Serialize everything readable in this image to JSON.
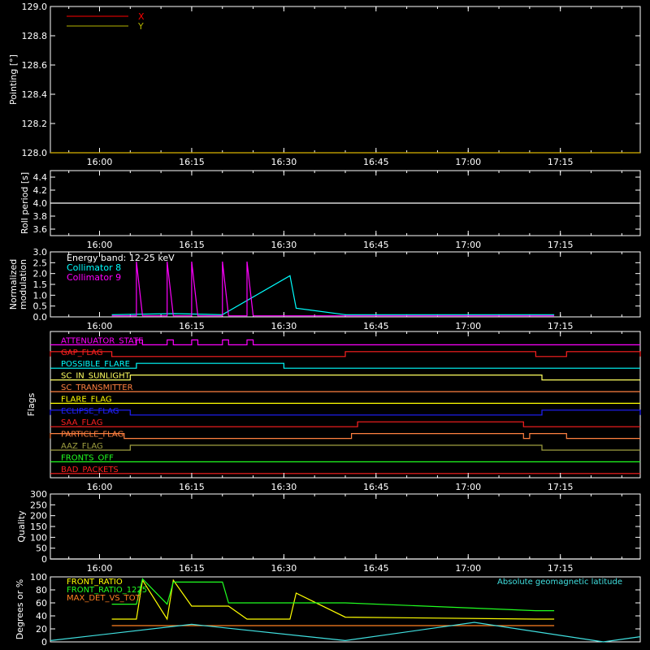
{
  "time_ticks": [
    "16:00",
    "16:15",
    "16:30",
    "16:45",
    "17:00",
    "17:15"
  ],
  "chart_data": [
    {
      "panel": "pointing",
      "type": "line",
      "ylabel": "Pointing [°]",
      "ylim": [
        128.0,
        129.0
      ],
      "yticks": [
        "129.0",
        "128.8",
        "128.6",
        "128.4",
        "128.2",
        "128.0"
      ],
      "series": [
        {
          "name": "X",
          "color": "#ff0000",
          "x": [
            "15:52",
            "17:28"
          ],
          "y": [
            128.0,
            128.0
          ]
        },
        {
          "name": "Y",
          "color": "#b4b400",
          "x": [
            "15:52",
            "17:28"
          ],
          "y": [
            128.0,
            128.0
          ]
        }
      ]
    },
    {
      "panel": "roll",
      "type": "line",
      "ylabel": "Roll period [s]",
      "ylim": [
        3.5,
        4.5
      ],
      "yticks": [
        "4.4",
        "4.2",
        "4.0",
        "3.8",
        "3.6"
      ],
      "series": [
        {
          "color": "#ffffff",
          "x": [
            "15:52",
            "17:28"
          ],
          "y": [
            4.0,
            4.0
          ]
        }
      ]
    },
    {
      "panel": "modulation",
      "type": "line",
      "ylabel": "Normalized modulation",
      "ylim": [
        0,
        3.0
      ],
      "yticks": [
        "3.0",
        "2.5",
        "2.0",
        "1.5",
        "1.0",
        "0.5",
        "0.0"
      ],
      "annotations": [
        "Energy band: 12-25 keV"
      ],
      "series": [
        {
          "name": "Collimator 8",
          "color": "#00ffff",
          "x": [
            "16:02",
            "16:12",
            "16:20",
            "16:31",
            "16:32",
            "16:40",
            "17:11",
            "17:14"
          ],
          "y": [
            0.1,
            0.15,
            0.1,
            1.9,
            0.4,
            0.1,
            0.1,
            0.1
          ]
        },
        {
          "name": "Collimator 9",
          "color": "#ff00ff",
          "x": [
            "16:02",
            "16:06",
            "16:06",
            "16:07",
            "16:11",
            "16:11",
            "16:12",
            "16:15",
            "16:15",
            "16:16",
            "16:20",
            "16:20",
            "16:21",
            "16:24",
            "16:24",
            "16:25",
            "16:40",
            "17:11",
            "17:14"
          ],
          "y": [
            0.05,
            0.05,
            2.55,
            0.05,
            0.05,
            2.55,
            0.05,
            0.05,
            2.55,
            0.05,
            0.05,
            2.55,
            0.05,
            0.05,
            2.55,
            0.05,
            0.05,
            0.05,
            0.05
          ]
        }
      ]
    },
    {
      "panel": "flags",
      "type": "line",
      "ylabel": "Flags",
      "flags": [
        {
          "name": "ATTENUATOR_STATE",
          "color": "#ff00ff",
          "high": [
            [
              "16:06",
              "16:07"
            ],
            [
              "16:11",
              "16:12"
            ],
            [
              "16:15",
              "16:16"
            ],
            [
              "16:20",
              "16:21"
            ],
            [
              "16:24",
              "16:25"
            ]
          ]
        },
        {
          "name": "GAP_FLAG",
          "color": "#ff2020",
          "high": [
            [
              "15:52",
              "16:02"
            ],
            [
              "16:40",
              "17:11"
            ],
            [
              "17:16",
              "17:28"
            ]
          ]
        },
        {
          "name": "POSSIBLE_FLARE",
          "color": "#00ffff",
          "high": [
            [
              "16:06",
              "16:30"
            ]
          ]
        },
        {
          "name": "SC_IN_SUNLIGHT",
          "color": "#ffff60",
          "high": [
            [
              "16:05",
              "17:12"
            ]
          ]
        },
        {
          "name": "SC_TRANSMITTER",
          "color": "#ff8040",
          "high": []
        },
        {
          "name": "FLARE_FLAG",
          "color": "#ffff00",
          "high": []
        },
        {
          "name": "ECLIPSE_FLAG",
          "color": "#2020ff",
          "high": [
            [
              "15:52",
              "16:05"
            ],
            [
              "17:12",
              "17:28"
            ]
          ]
        },
        {
          "name": "SAA_FLAG",
          "color": "#ff2020",
          "high": [
            [
              "16:42",
              "17:09"
            ]
          ]
        },
        {
          "name": "PARTICLE_FLAG",
          "color": "#ff8040",
          "high": [
            [
              "15:52",
              "16:04"
            ],
            [
              "16:41",
              "17:09"
            ],
            [
              "17:10",
              "17:16"
            ]
          ]
        },
        {
          "name": "AAZ_FLAG",
          "color": "#a0a040",
          "high": [
            [
              "16:05",
              "17:12"
            ]
          ]
        },
        {
          "name": "FRONTS_OFF",
          "color": "#20ff20",
          "high": []
        },
        {
          "name": "BAD_PACKETS",
          "color": "#ff2020",
          "high": []
        }
      ]
    },
    {
      "panel": "quality",
      "type": "line",
      "ylabel": "Quality",
      "ylim": [
        0,
        300
      ],
      "yticks": [
        "300",
        "250",
        "200",
        "150",
        "100",
        "50",
        "0"
      ],
      "series": [
        {
          "color": "#ffffff",
          "x": [
            "15:52",
            "17:28"
          ],
          "y": [
            0,
            0
          ]
        }
      ]
    },
    {
      "panel": "ratios",
      "type": "line",
      "ylabel": "Degrees or %",
      "ylim": [
        0,
        100
      ],
      "yticks": [
        "100",
        "80",
        "60",
        "40",
        "20",
        "0"
      ],
      "series": [
        {
          "name": "FRONT_RATIO",
          "color": "#ffff00",
          "x": [
            "16:02",
            "16:06",
            "16:07",
            "16:11",
            "16:12",
            "16:15",
            "16:16",
            "16:20",
            "16:21",
            "16:24",
            "16:25",
            "16:31",
            "16:32",
            "16:40",
            "17:11",
            "17:14"
          ],
          "y": [
            35,
            35,
            95,
            35,
            95,
            55,
            55,
            55,
            55,
            35,
            35,
            35,
            75,
            38,
            35,
            35
          ]
        },
        {
          "name": "FRONT_RATIO_1225",
          "color": "#20ff20",
          "x": [
            "16:02",
            "16:06",
            "16:07",
            "16:11",
            "16:12",
            "16:15",
            "16:16",
            "16:20",
            "16:21",
            "16:24",
            "16:25",
            "16:31",
            "16:32",
            "16:40",
            "17:11",
            "17:14"
          ],
          "y": [
            58,
            58,
            97,
            58,
            92,
            92,
            92,
            92,
            60,
            60,
            60,
            60,
            60,
            60,
            48,
            48
          ]
        },
        {
          "name": "MAX_DET_VS_TOT",
          "color": "#ff8020",
          "x": [
            "16:02",
            "16:40",
            "17:11",
            "17:14"
          ],
          "y": [
            25,
            25,
            25,
            25
          ]
        },
        {
          "name": "Absolute geomagnetic latitude",
          "color": "#40e0e0",
          "x": [
            "15:52",
            "16:15",
            "16:40",
            "17:01",
            "17:22",
            "17:28"
          ],
          "y": [
            2,
            27,
            2,
            30,
            0,
            8
          ]
        }
      ]
    }
  ]
}
